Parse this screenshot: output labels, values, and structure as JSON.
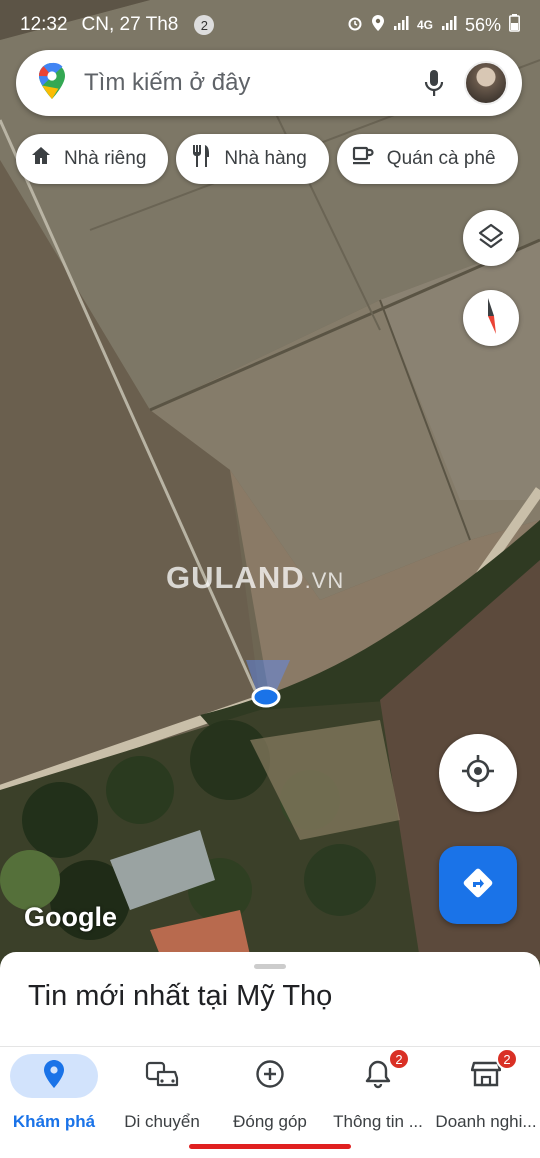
{
  "status_bar": {
    "time": "12:32",
    "date": "CN, 27 Th8",
    "notification_count": "2",
    "network": "4G",
    "battery": "56%"
  },
  "search": {
    "placeholder": "Tìm kiếm ở đây"
  },
  "chips": [
    {
      "label": "Nhà riêng",
      "icon": "home-icon"
    },
    {
      "label": "Nhà hàng",
      "icon": "restaurant-icon"
    },
    {
      "label": "Quán cà phê",
      "icon": "coffee-icon"
    }
  ],
  "map": {
    "watermark_main": "GULAND",
    "watermark_suffix": ".VN",
    "logo": "Google"
  },
  "sheet": {
    "title": "Tin mới nhất tại Mỹ Thọ"
  },
  "nav": {
    "items": [
      {
        "label": "Khám phá",
        "icon": "explore-pin-icon",
        "active": true
      },
      {
        "label": "Di chuyển",
        "icon": "commute-icon"
      },
      {
        "label": "Đóng góp",
        "icon": "contribute-icon"
      },
      {
        "label": "Thông tin ...",
        "icon": "updates-bell-icon",
        "badge": "2"
      },
      {
        "label": "Doanh nghi...",
        "icon": "business-icon",
        "badge": "2"
      }
    ]
  },
  "colors": {
    "accent": "#1a73e8",
    "badge": "#d93025",
    "active_pill": "#d2e3fc"
  }
}
